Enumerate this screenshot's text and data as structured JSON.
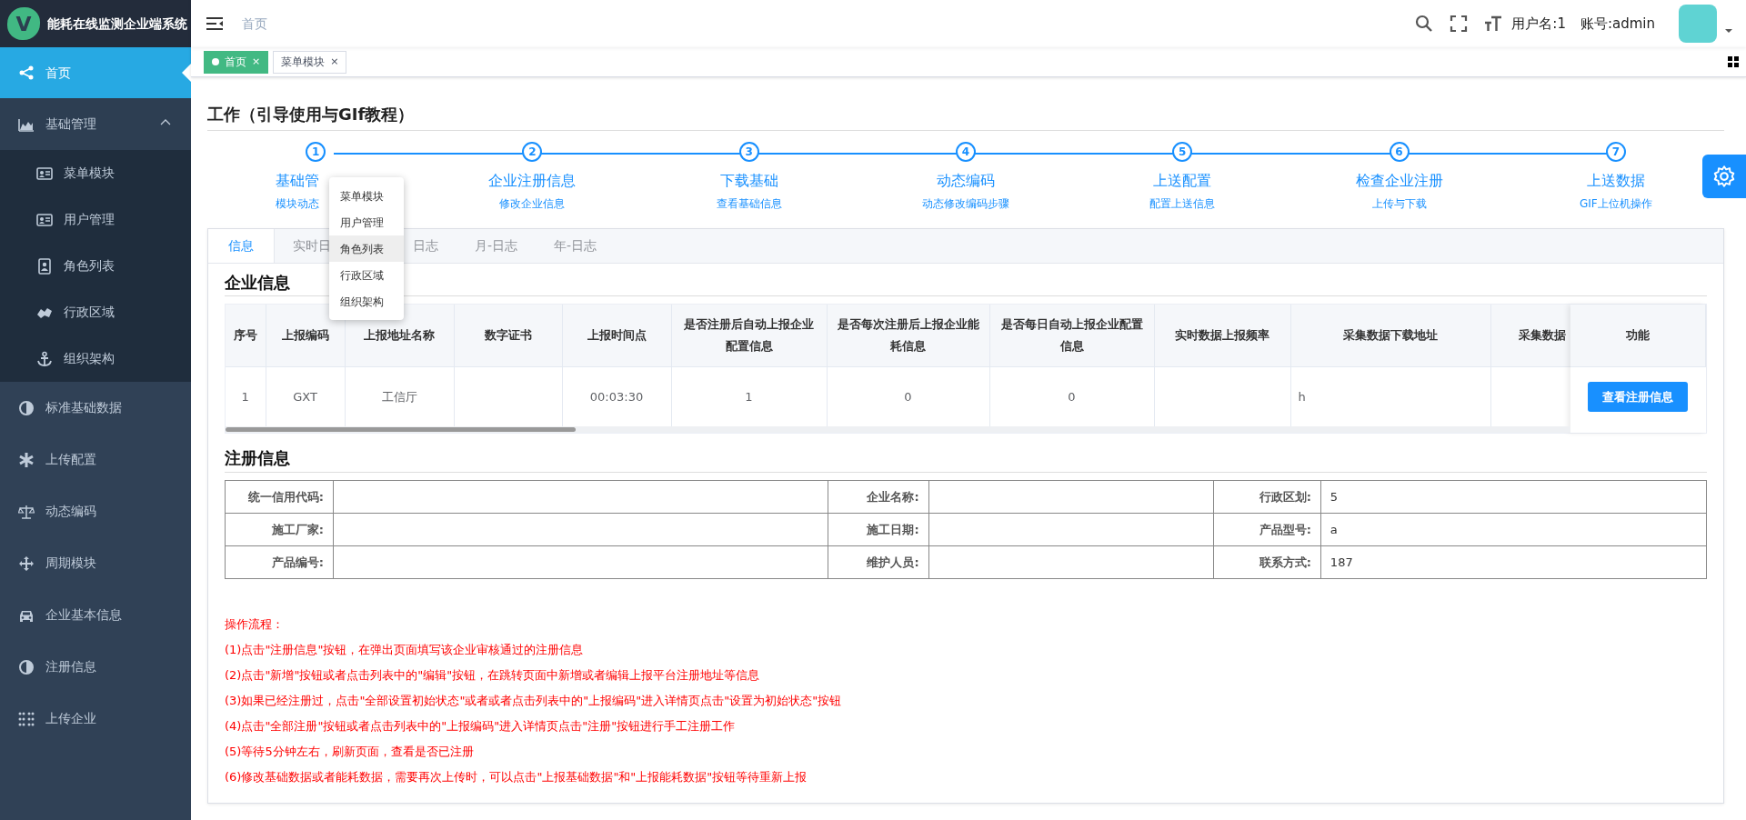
{
  "sidebar": {
    "title": "能耗在线监测企业端系统",
    "logo_letter": "V",
    "items": [
      {
        "label": "首页",
        "kind": "item",
        "selected": true
      },
      {
        "label": "基础管理",
        "kind": "group",
        "selected": false,
        "expanded": true,
        "children": [
          {
            "label": "菜单模块",
            "selected": false
          },
          {
            "label": "用户管理",
            "selected": false
          },
          {
            "label": "角色列表",
            "selected": false
          },
          {
            "label": "行政区域",
            "selected": false
          },
          {
            "label": "组织架构",
            "selected": false
          }
        ]
      },
      {
        "label": "标准基础数据",
        "kind": "item",
        "selected": false
      },
      {
        "label": "上传配置",
        "kind": "item",
        "selected": false
      },
      {
        "label": "动态编码",
        "kind": "item",
        "selected": false
      },
      {
        "label": "周期模块",
        "kind": "item",
        "selected": false
      },
      {
        "label": "企业基本信息",
        "kind": "item",
        "selected": false
      },
      {
        "label": "注册信息",
        "kind": "item",
        "selected": false
      },
      {
        "label": "上传企业",
        "kind": "item",
        "selected": false
      }
    ]
  },
  "header": {
    "breadcrumb": "首页",
    "username": "用户名:1",
    "account": "账号:admin"
  },
  "tags": [
    {
      "label": "首页",
      "selected": true,
      "close": "×"
    },
    {
      "label": "菜单模块",
      "selected": false,
      "close": "×"
    }
  ],
  "page_title": "工作（引导使用与GIf教程）",
  "steps": [
    {
      "number": "1",
      "title": "基础管",
      "subtitle": "模块动态"
    },
    {
      "number": "2",
      "title": "企业注册信息",
      "subtitle": "修改企业信息"
    },
    {
      "number": "3",
      "title": "下载基础",
      "subtitle": "查看基础信息"
    },
    {
      "number": "4",
      "title": "动态编码",
      "subtitle": "动态修改编码步骤"
    },
    {
      "number": "5",
      "title": "上送配置",
      "subtitle": "配置上送信息"
    },
    {
      "number": "6",
      "title": "检查企业注册",
      "subtitle": "上传与下载"
    },
    {
      "number": "7",
      "title": "上送数据",
      "subtitle": "GIF上位机操作"
    }
  ],
  "popup_menu": {
    "items": [
      {
        "label": "菜单模块",
        "selected": false
      },
      {
        "label": "用户管理",
        "selected": false
      },
      {
        "label": "角色列表",
        "selected": true
      },
      {
        "label": "行政区域",
        "selected": false
      },
      {
        "label": "组织架构",
        "selected": false
      }
    ]
  },
  "tabs": [
    {
      "label": "信息",
      "selected": true
    },
    {
      "label": "实时日",
      "selected": false
    },
    {
      "label": "日志",
      "selected": false
    },
    {
      "label": "月-日志",
      "selected": false
    },
    {
      "label": "年-日志",
      "selected": false
    }
  ],
  "company_section": {
    "title": "企业信息",
    "table": {
      "columns": [
        "序号",
        "上报编码",
        "上报地址名称",
        "数字证书",
        "上报时间点",
        "是否注册后自动上报企业配置信息",
        "是否每次注册后上报企业能耗信息",
        "是否每日自动上报企业配置信息",
        "实时数据上报频率",
        "采集数据下载地址",
        "采集数据"
      ],
      "action_column": "功能",
      "rows": [
        {
          "cells": [
            "1",
            "GXT",
            "工信厅",
            "",
            "00:03:30",
            "1",
            "0",
            "0",
            "",
            "h",
            ""
          ],
          "action": "查看注册信息"
        }
      ]
    }
  },
  "registration_section": {
    "title": "注册信息",
    "rows": [
      [
        {
          "label": "统一信用代码:"
        },
        {
          "label": "企业名称:"
        },
        {
          "label": "行政区划:",
          "value": "5"
        }
      ],
      [
        {
          "label": "施工厂家:"
        },
        {
          "label": "施工日期:"
        },
        {
          "label": "产品型号:",
          "value": "a"
        }
      ],
      [
        {
          "label": "产品编号:"
        },
        {
          "label": "维护人员:"
        },
        {
          "label": "联系方式:",
          "value": "187"
        }
      ]
    ]
  },
  "instructions": {
    "title": "操作流程：",
    "lines": [
      "(1)点击\"注册信息\"按钮，在弹出页面填写该企业审核通过的注册信息",
      "(2)点击\"新增\"按钮或者点击列表中的\"编辑\"按钮，在跳转页面中新增或者编辑上报平台注册地址等信息",
      "(3)如果已经注册过，点击\"全部设置初始状态\"或者或者点击列表中的\"上报编码\"进入详情页点击\"设置为初始状态\"按钮",
      "(4)点击\"全部注册\"按钮或者点击列表中的\"上报编码\"进入详情页点击\"注册\"按钮进行手工注册工作",
      "(5)等待5分钟左右，刷新页面，查看是否已注册",
      "(6)修改基础数据或者能耗数据，需要再次上传时，可以点击\"上报基础数据\"和\"上报能耗数据\"按钮等待重新上报"
    ]
  }
}
